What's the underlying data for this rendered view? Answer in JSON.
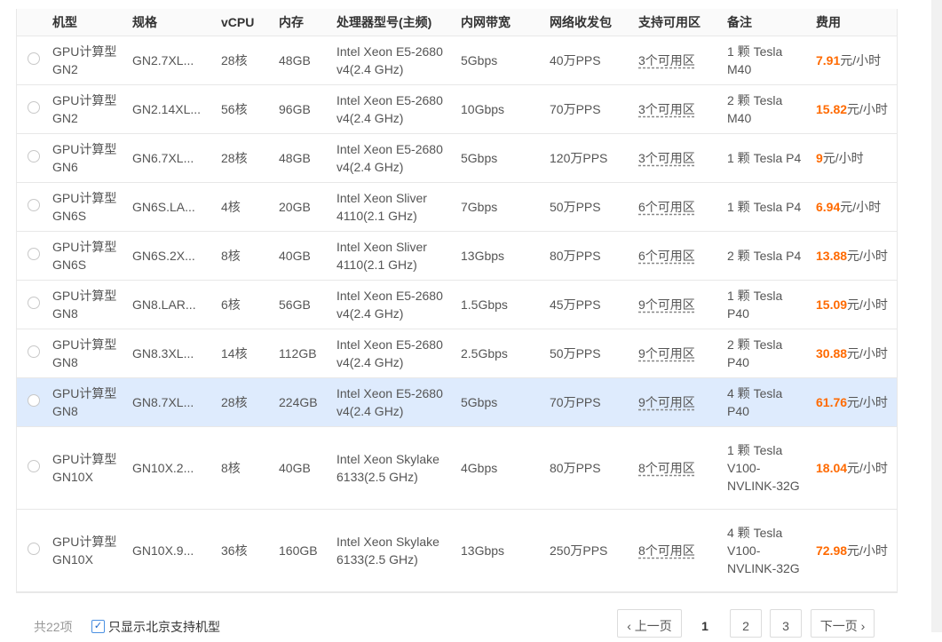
{
  "table": {
    "headers": [
      "",
      "机型",
      "规格",
      "vCPU",
      "内存",
      "处理器型号(主频)",
      "内网带宽",
      "网络收发包",
      "支持可用区",
      "备注",
      "费用"
    ],
    "rows": [
      {
        "type": "GPU计算型GN2",
        "spec": "GN2.7XL...",
        "vcpu": "28核",
        "mem": "48GB",
        "cpu": "Intel Xeon E5-2680 v4(2.4 GHz)",
        "bw": "5Gbps",
        "pps": "40万PPS",
        "zones": "3个可用区",
        "note": "1 颗 Tesla M40",
        "price": "7.91",
        "unit": "元/小时"
      },
      {
        "type": "GPU计算型GN2",
        "spec": "GN2.14XL...",
        "vcpu": "56核",
        "mem": "96GB",
        "cpu": "Intel Xeon E5-2680 v4(2.4 GHz)",
        "bw": "10Gbps",
        "pps": "70万PPS",
        "zones": "3个可用区",
        "note": "2 颗 Tesla M40",
        "price": "15.82",
        "unit": "元/小时"
      },
      {
        "type": "GPU计算型GN6",
        "spec": "GN6.7XL...",
        "vcpu": "28核",
        "mem": "48GB",
        "cpu": "Intel Xeon E5-2680 v4(2.4 GHz)",
        "bw": "5Gbps",
        "pps": "120万PPS",
        "zones": "3个可用区",
        "note": "1 颗 Tesla P4",
        "price": "9",
        "unit": "元/小时"
      },
      {
        "type": "GPU计算型GN6S",
        "spec": "GN6S.LA...",
        "vcpu": "4核",
        "mem": "20GB",
        "cpu": "Intel Xeon Sliver 4110(2.1 GHz)",
        "bw": "7Gbps",
        "pps": "50万PPS",
        "zones": "6个可用区",
        "note": "1 颗 Tesla P4",
        "price": "6.94",
        "unit": "元/小时"
      },
      {
        "type": "GPU计算型GN6S",
        "spec": "GN6S.2X...",
        "vcpu": "8核",
        "mem": "40GB",
        "cpu": "Intel Xeon Sliver 4110(2.1 GHz)",
        "bw": "13Gbps",
        "pps": "80万PPS",
        "zones": "6个可用区",
        "note": "2 颗 Tesla P4",
        "price": "13.88",
        "unit": "元/小时"
      },
      {
        "type": "GPU计算型GN8",
        "spec": "GN8.LAR...",
        "vcpu": "6核",
        "mem": "56GB",
        "cpu": "Intel Xeon E5-2680 v4(2.4 GHz)",
        "bw": "1.5Gbps",
        "pps": "45万PPS",
        "zones": "9个可用区",
        "note": "1 颗 Tesla P40",
        "price": "15.09",
        "unit": "元/小时"
      },
      {
        "type": "GPU计算型GN8",
        "spec": "GN8.3XL...",
        "vcpu": "14核",
        "mem": "112GB",
        "cpu": "Intel Xeon E5-2680 v4(2.4 GHz)",
        "bw": "2.5Gbps",
        "pps": "50万PPS",
        "zones": "9个可用区",
        "note": "2 颗 Tesla P40",
        "price": "30.88",
        "unit": "元/小时"
      },
      {
        "type": "GPU计算型GN8",
        "spec": "GN8.7XL...",
        "vcpu": "28核",
        "mem": "224GB",
        "cpu": "Intel Xeon E5-2680 v4(2.4 GHz)",
        "bw": "5Gbps",
        "pps": "70万PPS",
        "zones": "9个可用区",
        "note": "4 颗 Tesla P40",
        "price": "61.76",
        "unit": "元/小时"
      },
      {
        "type": "GPU计算型GN10X",
        "spec": "GN10X.2...",
        "vcpu": "8核",
        "mem": "40GB",
        "cpu": "Intel Xeon Skylake 6133(2.5 GHz)",
        "bw": "4Gbps",
        "pps": "80万PPS",
        "zones": "8个可用区",
        "note": "1 颗 Tesla V100-NVLINK-32G",
        "price": "18.04",
        "unit": "元/小时"
      },
      {
        "type": "GPU计算型GN10X",
        "spec": "GN10X.9...",
        "vcpu": "36核",
        "mem": "160GB",
        "cpu": "Intel Xeon Skylake 6133(2.5 GHz)",
        "bw": "13Gbps",
        "pps": "250万PPS",
        "zones": "8个可用区",
        "note": "4 颗 Tesla V100-NVLINK-32G",
        "price": "72.98",
        "unit": "元/小时"
      }
    ]
  },
  "footer": {
    "total": "共22项",
    "filter_checkbox": "✓",
    "filter_label": "只显示北京支持机型",
    "prev": "‹ 上一页",
    "pages": [
      "1",
      "2",
      "3"
    ],
    "next": "下一页 ›"
  },
  "colors": {
    "price": "#ff6a00",
    "selected_row": "#deebfd",
    "header_bg": "#fafafa"
  }
}
